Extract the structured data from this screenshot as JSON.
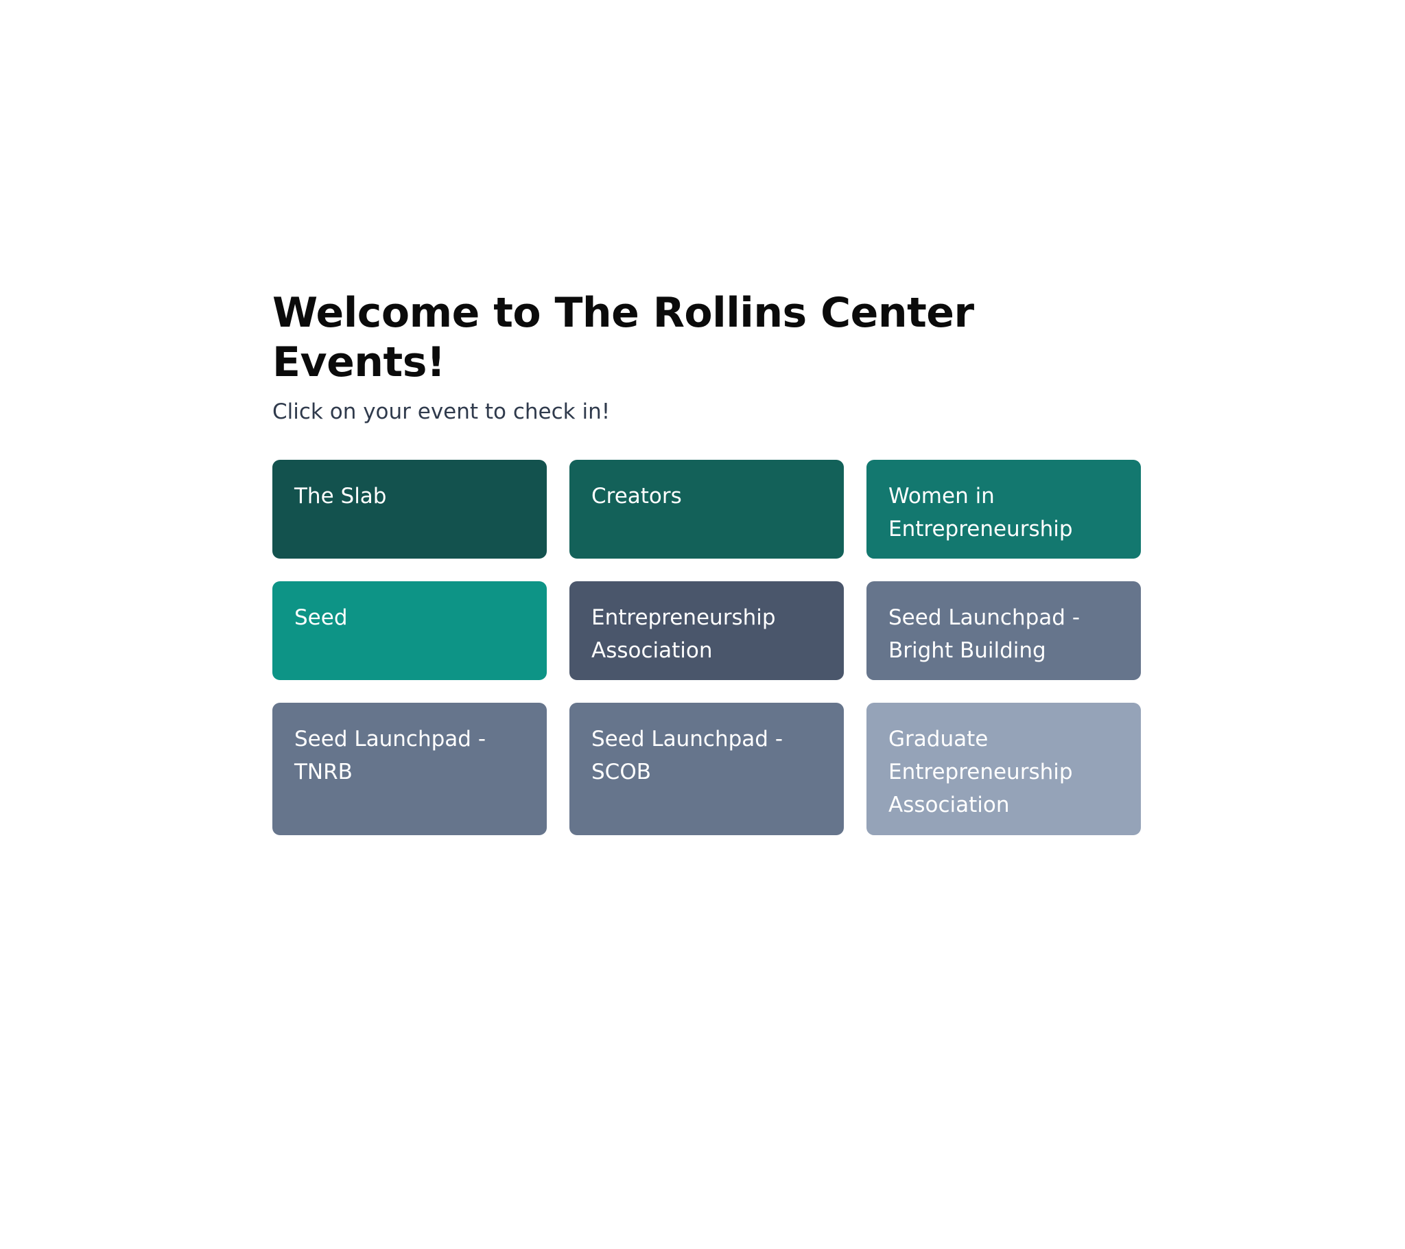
{
  "page": {
    "title": "Welcome to The Rollins Center Events!",
    "subtitle": "Click on your event to check in!"
  },
  "events": [
    {
      "label": "The Slab",
      "color": "#13524e"
    },
    {
      "label": "Creators",
      "color": "#136159"
    },
    {
      "label": "Women in\nEntrepreneurship",
      "color": "#13786f"
    },
    {
      "label": "Seed",
      "color": "#0d9486"
    },
    {
      "label": "Entrepreneurship\nAssociation",
      "color": "#4a566b"
    },
    {
      "label": "Seed Launchpad -\nBright Building",
      "color": "#66758c"
    },
    {
      "label": "Seed Launchpad -\nTNRB",
      "color": "#66758c"
    },
    {
      "label": "Seed Launchpad -\nSCOB",
      "color": "#66758c"
    },
    {
      "label": "Graduate\nEntrepreneurship\nAssociation",
      "color": "#95a3b8"
    }
  ]
}
